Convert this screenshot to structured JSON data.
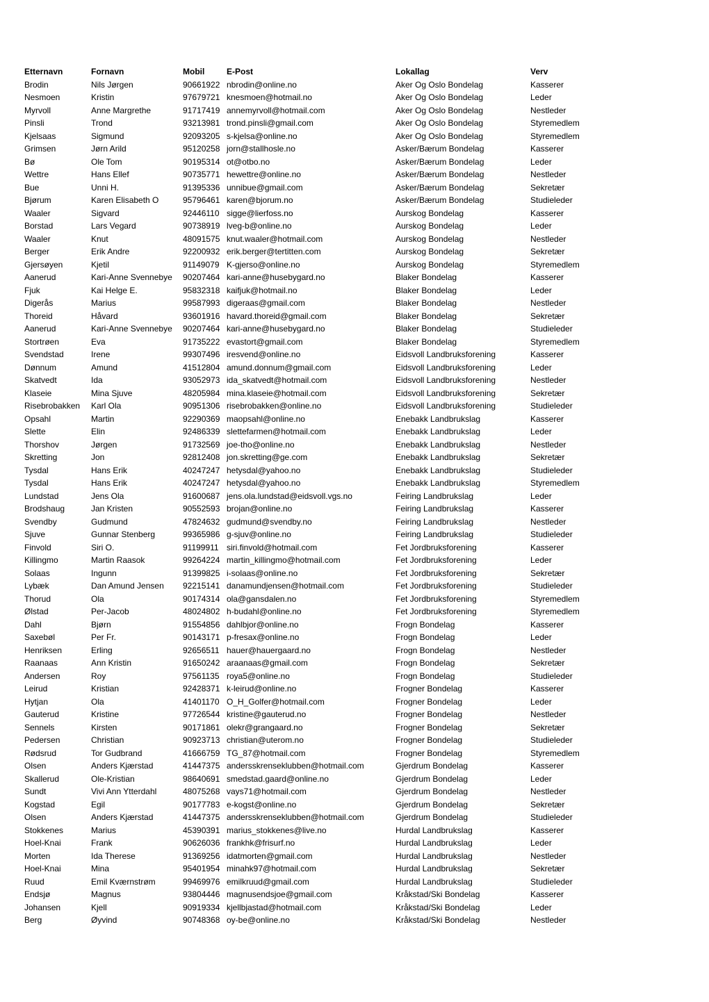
{
  "table": {
    "columns": [
      "Etternavn",
      "Fornavn",
      "Mobil",
      "E-Post",
      "Lokallag",
      "Verv"
    ],
    "rows": [
      [
        "Brodin",
        "Nils Jørgen",
        "90661922",
        "nbrodin@online.no",
        "Aker Og Oslo Bondelag",
        "Kasserer"
      ],
      [
        "Nesmoen",
        "Kristin",
        "97679721",
        "knesmoen@hotmail.no",
        "Aker Og Oslo Bondelag",
        "Leder"
      ],
      [
        "Myrvoll",
        "Anne Margrethe",
        "91717419",
        "annemyrvoll@hotmail.com",
        "Aker Og Oslo Bondelag",
        "Nestleder"
      ],
      [
        "Pinsli",
        "Trond",
        "93213981",
        "trond.pinsli@gmail.com",
        "Aker Og Oslo Bondelag",
        "Styremedlem"
      ],
      [
        "Kjelsaas",
        "Sigmund",
        "92093205",
        "s-kjelsa@online.no",
        "Aker Og Oslo Bondelag",
        "Styremedlem"
      ],
      [
        "Grimsen",
        "Jørn Arild",
        "95120258",
        "jorn@stallhosle.no",
        "Asker/Bærum Bondelag",
        "Kasserer"
      ],
      [
        "Bø",
        "Ole Tom",
        "90195314",
        "ot@otbo.no",
        "Asker/Bærum Bondelag",
        "Leder"
      ],
      [
        "Wettre",
        "Hans Ellef",
        "90735771",
        "hewettre@online.no",
        "Asker/Bærum Bondelag",
        "Nestleder"
      ],
      [
        "Bue",
        "Unni H.",
        "91395336",
        "unnibue@gmail.com",
        "Asker/Bærum Bondelag",
        "Sekretær"
      ],
      [
        "Bjørum",
        "Karen Elisabeth O",
        "95796461",
        "karen@bjorum.no",
        "Asker/Bærum Bondelag",
        "Studieleder"
      ],
      [
        "Waaler",
        "Sigvard",
        "92446110",
        "sigge@lierfoss.no",
        "Aurskog Bondelag",
        "Kasserer"
      ],
      [
        "Borstad",
        "Lars Vegard",
        "90738919",
        "lveg-b@online.no",
        "Aurskog Bondelag",
        "Leder"
      ],
      [
        "Waaler",
        "Knut",
        "48091575",
        "knut.waaler@hotmail.com",
        "Aurskog Bondelag",
        "Nestleder"
      ],
      [
        "Berger",
        "Erik Andre",
        "92200932",
        "erik.berger@tertitten.com",
        "Aurskog Bondelag",
        "Sekretær"
      ],
      [
        "Gjersøyen",
        "Kjetil",
        "91149079",
        "K-gjerso@online.no",
        "Aurskog Bondelag",
        "Styremedlem"
      ],
      [
        "Aanerud",
        "Kari-Anne Svennebye",
        "90207464",
        "kari-anne@husebygard.no",
        "Blaker Bondelag",
        "Kasserer"
      ],
      [
        "Fjuk",
        "Kai Helge E.",
        "95832318",
        "kaifjuk@hotmail.no",
        "Blaker Bondelag",
        "Leder"
      ],
      [
        "Digerås",
        "Marius",
        "99587993",
        "digeraas@gmail.com",
        "Blaker Bondelag",
        "Nestleder"
      ],
      [
        "Thoreid",
        "Håvard",
        "93601916",
        "havard.thoreid@gmail.com",
        "Blaker Bondelag",
        "Sekretær"
      ],
      [
        "Aanerud",
        "Kari-Anne Svennebye",
        "90207464",
        "kari-anne@husebygard.no",
        "Blaker Bondelag",
        "Studieleder"
      ],
      [
        "Stortrøen",
        "Eva",
        "91735222",
        "evastort@gmail.com",
        "Blaker Bondelag",
        "Styremedlem"
      ],
      [
        "Svendstad",
        "Irene",
        "99307496",
        "iresvend@online.no",
        "Eidsvoll Landbruksforening",
        "Kasserer"
      ],
      [
        "Dønnum",
        "Amund",
        "41512804",
        "amund.donnum@gmail.com",
        "Eidsvoll Landbruksforening",
        "Leder"
      ],
      [
        "Skatvedt",
        "Ida",
        "93052973",
        "ida_skatvedt@hotmail.com",
        "Eidsvoll Landbruksforening",
        "Nestleder"
      ],
      [
        "Klaseie",
        "Mina Sjuve",
        "48205984",
        "mina.klaseie@hotmail.com",
        "Eidsvoll Landbruksforening",
        "Sekretær"
      ],
      [
        "Risebrobakken",
        "Karl Ola",
        "90951306",
        "risebrobakken@online.no",
        "Eidsvoll Landbruksforening",
        "Studieleder"
      ],
      [
        "Opsahl",
        "Martin",
        "92290369",
        "maopsahl@online.no",
        "Enebakk Landbrukslag",
        "Kasserer"
      ],
      [
        "Slette",
        "Elin",
        "92486339",
        "slettefarmen@hotmail.com",
        "Enebakk Landbrukslag",
        "Leder"
      ],
      [
        "Thorshov",
        "Jørgen",
        "91732569",
        "joe-tho@online.no",
        "Enebakk Landbrukslag",
        "Nestleder"
      ],
      [
        "Skretting",
        "Jon",
        "92812408",
        "jon.skretting@ge.com",
        "Enebakk Landbrukslag",
        "Sekretær"
      ],
      [
        "Tysdal",
        "Hans Erik",
        "40247247",
        "hetysdal@yahoo.no",
        "Enebakk Landbrukslag",
        "Studieleder"
      ],
      [
        "Tysdal",
        "Hans Erik",
        "40247247",
        "hetysdal@yahoo.no",
        "Enebakk Landbrukslag",
        "Styremedlem"
      ],
      [
        "Lundstad",
        "Jens Ola",
        "91600687",
        "jens.ola.lundstad@eidsvoll.vgs.no",
        "Feiring Landbrukslag",
        "Leder"
      ],
      [
        "Brodshaug",
        "Jan Kristen",
        "90552593",
        "brojan@online.no",
        "Feiring Landbrukslag",
        "Kasserer"
      ],
      [
        "Svendby",
        "Gudmund",
        "47824632",
        "gudmund@svendby.no",
        "Feiring Landbrukslag",
        "Nestleder"
      ],
      [
        "Sjuve",
        "Gunnar Stenberg",
        "99365986",
        "g-sjuv@online.no",
        "Feiring Landbrukslag",
        "Studieleder"
      ],
      [
        "Finvold",
        "Siri O.",
        "91199911",
        "siri.finvold@hotmail.com",
        "Fet Jordbruksforening",
        "Kasserer"
      ],
      [
        "Killingmo",
        "Martin Raasok",
        "99264224",
        "martin_killingmo@hotmail.com",
        "Fet Jordbruksforening",
        "Leder"
      ],
      [
        "Solaas",
        "Ingunn",
        "91399825",
        "i-solaas@online.no",
        "Fet Jordbruksforening",
        "Sekretær"
      ],
      [
        "Lybæk",
        "Dan Amund Jensen",
        "92215141",
        "danamundjensen@hotmail.com",
        "Fet Jordbruksforening",
        "Studieleder"
      ],
      [
        "Thorud",
        "Ola",
        "90174314",
        "ola@gansdalen.no",
        "Fet Jordbruksforening",
        "Styremedlem"
      ],
      [
        "Ølstad",
        "Per-Jacob",
        "48024802",
        "h-budahl@online.no",
        "Fet Jordbruksforening",
        "Styremedlem"
      ],
      [
        "Dahl",
        "Bjørn",
        "91554856",
        "dahlbjor@online.no",
        "Frogn Bondelag",
        "Kasserer"
      ],
      [
        "Saxebøl",
        "Per Fr.",
        "90143171",
        "p-fresax@online.no",
        "Frogn Bondelag",
        "Leder"
      ],
      [
        "Henriksen",
        "Erling",
        "92656511",
        "hauer@hauergaard.no",
        "Frogn Bondelag",
        "Nestleder"
      ],
      [
        "Raanaas",
        "Ann Kristin",
        "91650242",
        "araanaas@gmail.com",
        "Frogn Bondelag",
        "Sekretær"
      ],
      [
        "Andersen",
        "Roy",
        "97561135",
        "roya5@online.no",
        "Frogn Bondelag",
        "Studieleder"
      ],
      [
        "Leirud",
        "Kristian",
        "92428371",
        "k-leirud@online.no",
        "Frogner Bondelag",
        "Kasserer"
      ],
      [
        "Hytjan",
        "Ola",
        "41401170",
        "O_H_Golfer@hotmail.com",
        "Frogner Bondelag",
        "Leder"
      ],
      [
        "Gauterud",
        "Kristine",
        "97726544",
        "kristine@gauterud.no",
        "Frogner Bondelag",
        "Nestleder"
      ],
      [
        "Sennels",
        "Kirsten",
        "90171861",
        "olekr@grangaard.no",
        "Frogner Bondelag",
        "Sekretær"
      ],
      [
        "Pedersen",
        "Christian",
        "90923713",
        "christian@uterom.no",
        "Frogner Bondelag",
        "Studieleder"
      ],
      [
        "Rødsrud",
        "Tor Gudbrand",
        "41666759",
        "TG_87@hotmail.com",
        "Frogner Bondelag",
        "Styremedlem"
      ],
      [
        "Olsen",
        "Anders Kjærstad",
        "41447375",
        "andersskrenseklubben@hotmail.com",
        "Gjerdrum Bondelag",
        "Kasserer"
      ],
      [
        "Skallerud",
        "Ole-Kristian",
        "98640691",
        "smedstad.gaard@online.no",
        "Gjerdrum Bondelag",
        "Leder"
      ],
      [
        "Sundt",
        "Vivi Ann Ytterdahl",
        "48075268",
        "vays71@hotmail.com",
        "Gjerdrum Bondelag",
        "Nestleder"
      ],
      [
        "Kogstad",
        "Egil",
        "90177783",
        "e-kogst@online.no",
        "Gjerdrum Bondelag",
        "Sekretær"
      ],
      [
        "Olsen",
        "Anders Kjærstad",
        "41447375",
        "andersskrenseklubben@hotmail.com",
        "Gjerdrum Bondelag",
        "Studieleder"
      ],
      [
        "Stokkenes",
        "Marius",
        "45390391",
        "marius_stokkenes@live.no",
        "Hurdal Landbrukslag",
        "Kasserer"
      ],
      [
        "Hoel-Knai",
        "Frank",
        "90626036",
        "frankhk@frisurf.no",
        "Hurdal Landbrukslag",
        "Leder"
      ],
      [
        "Morten",
        "Ida Therese",
        "91369256",
        "idatmorten@gmail.com",
        "Hurdal Landbrukslag",
        "Nestleder"
      ],
      [
        "Hoel-Knai",
        "Mina",
        "95401954",
        "minahk97@hotmail.com",
        "Hurdal Landbrukslag",
        "Sekretær"
      ],
      [
        "Ruud",
        "Emil Kværnstrøm",
        "99469976",
        "emilkruud@gmail.com",
        "Hurdal Landbrukslag",
        "Studieleder"
      ],
      [
        "Endsjø",
        "Magnus",
        "93804446",
        "magnusendsjoe@gmail.com",
        "Kråkstad/Ski Bondelag",
        "Kasserer"
      ],
      [
        "Johansen",
        "Kjell",
        "90919334",
        "kjellbjastad@hotmail.com",
        "Kråkstad/Ski Bondelag",
        "Leder"
      ],
      [
        "Berg",
        "Øyvind",
        "90748368",
        "oy-be@online.no",
        "Kråkstad/Ski Bondelag",
        "Nestleder"
      ]
    ]
  }
}
